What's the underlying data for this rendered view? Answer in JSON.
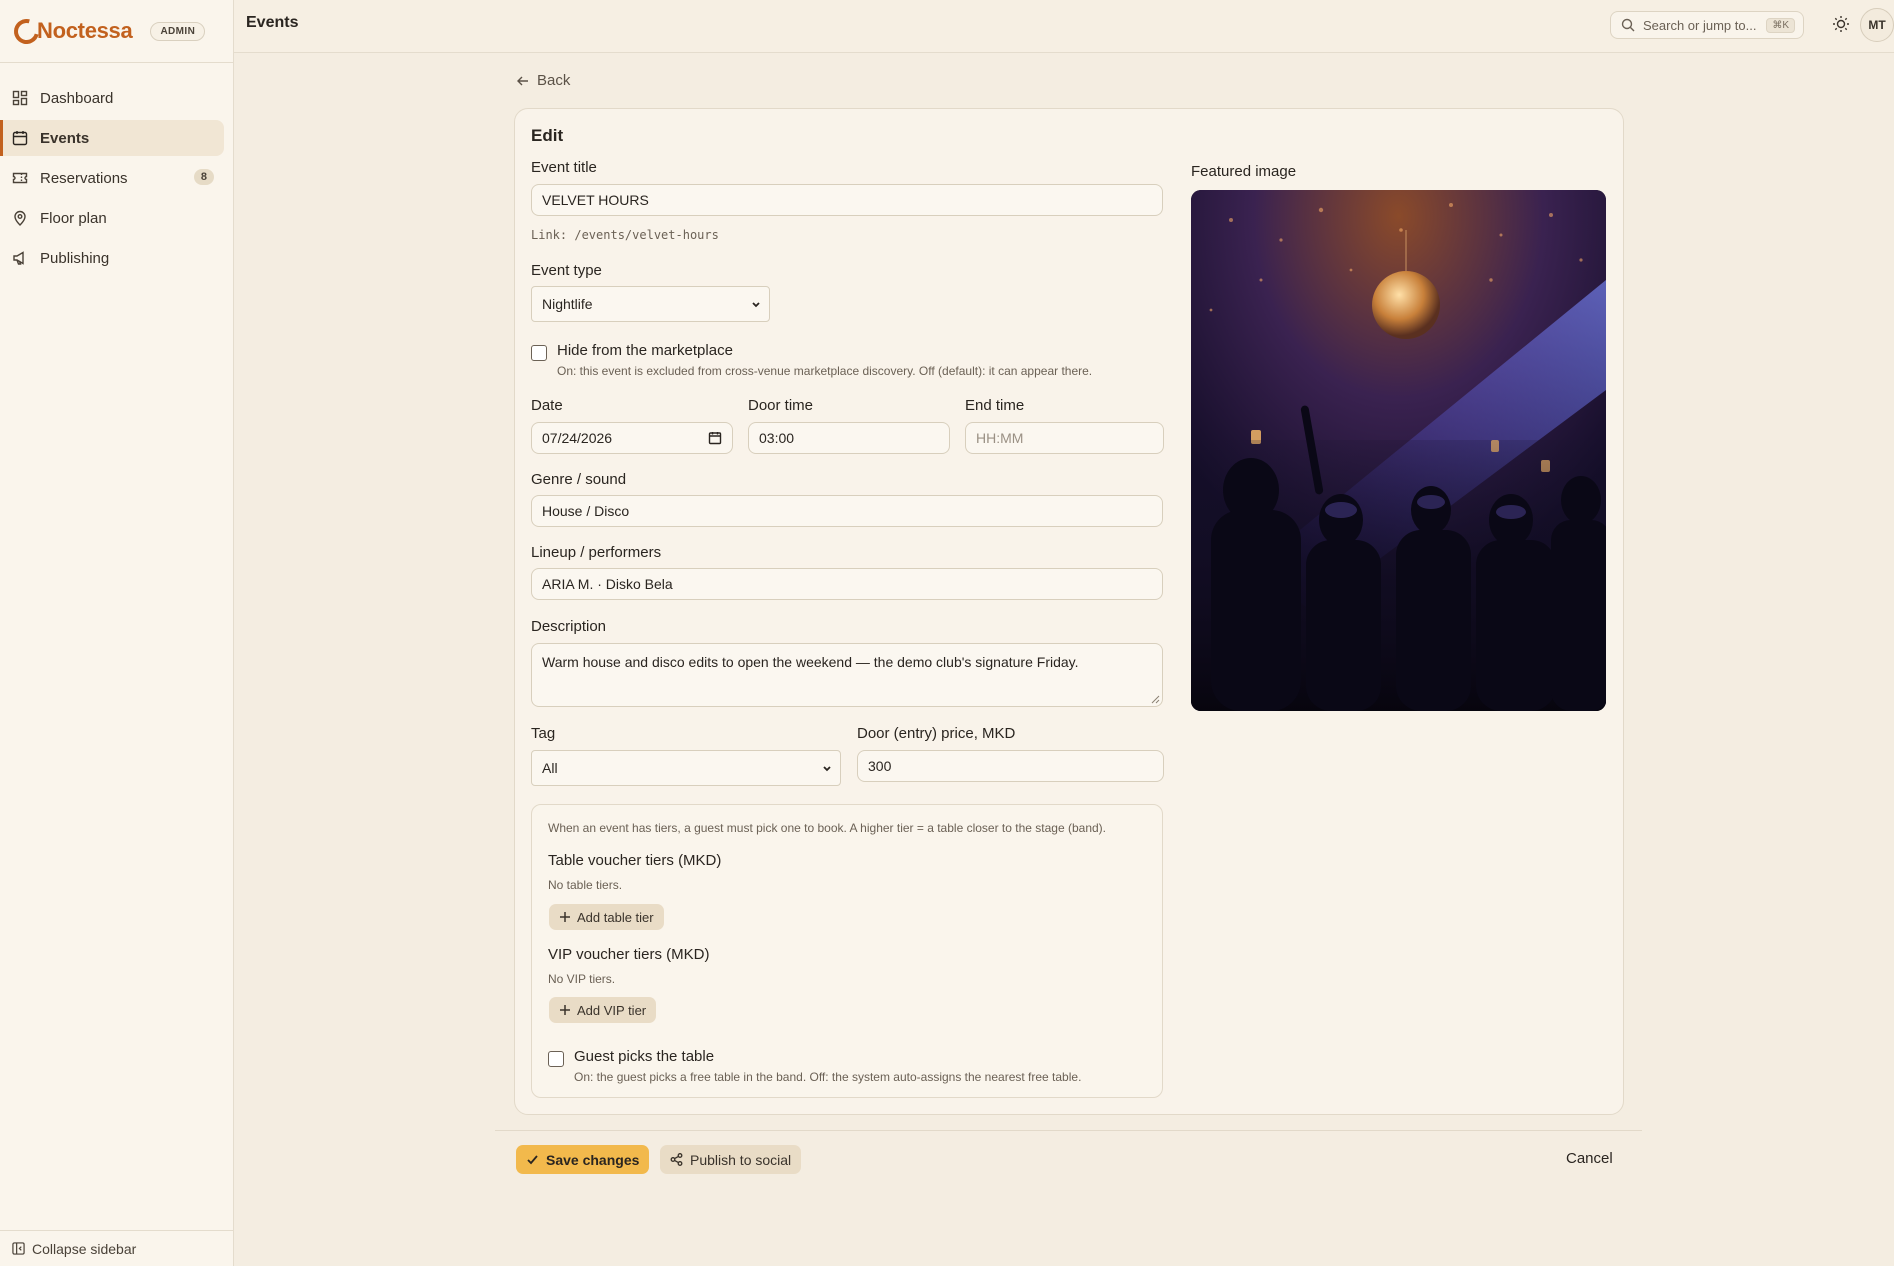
{
  "brand": {
    "name": "Noctessa",
    "badge": "ADMIN"
  },
  "sidebar": {
    "items": [
      {
        "label": "Dashboard",
        "icon": "grid-icon",
        "active": false
      },
      {
        "label": "Events",
        "icon": "calendar-icon",
        "active": true
      },
      {
        "label": "Reservations",
        "icon": "ticket-icon",
        "active": false,
        "badge": "8"
      },
      {
        "label": "Floor plan",
        "icon": "map-pin-icon",
        "active": false
      },
      {
        "label": "Publishing",
        "icon": "megaphone-icon",
        "active": false
      }
    ],
    "collapse_label": "Collapse sidebar"
  },
  "topbar": {
    "title": "Events",
    "search_placeholder": "Search or jump to...",
    "search_shortcut": "⌘K",
    "avatar_initials": "MT"
  },
  "page": {
    "back_label": "Back",
    "card_title": "Edit"
  },
  "form": {
    "title_label": "Event title",
    "title_value": "VELVET HOURS",
    "link_text": "Link: /events/velvet-hours",
    "type_label": "Event type",
    "type_value": "Nightlife",
    "hide_label": "Hide from the marketplace",
    "hide_hint": "On: this event is excluded from cross-venue marketplace discovery. Off (default): it can appear there.",
    "date_label": "Date",
    "date_value": "07/24/2026",
    "door_label": "Door time",
    "door_value": "03:00",
    "end_label": "End time",
    "end_placeholder": "HH:MM",
    "genre_label": "Genre / sound",
    "genre_value": "House / Disco",
    "lineup_label": "Lineup / performers",
    "lineup_value": "ARIA M. · Disko Bela",
    "desc_label": "Description",
    "desc_value": "Warm house and disco edits to open the weekend — the demo club's signature Friday.",
    "tag_label": "Tag",
    "tag_value": "All",
    "price_label": "Door (entry) price, MKD",
    "price_value": "300"
  },
  "tiers": {
    "intro": "When an event has tiers, a guest must pick one to book. A higher tier = a table closer to the stage (band).",
    "table_title": "Table voucher tiers (MKD)",
    "table_empty": "No table tiers.",
    "table_add": "Add table tier",
    "vip_title": "VIP voucher tiers (MKD)",
    "vip_empty": "No VIP tiers.",
    "vip_add": "Add VIP tier",
    "guest_label": "Guest picks the table",
    "guest_hint": "On: the guest picks a free table in the band. Off: the system auto-assigns the nearest free table."
  },
  "image": {
    "label": "Featured image"
  },
  "actions": {
    "save": "Save changes",
    "publish": "Publish to social",
    "cancel": "Cancel"
  },
  "colors": {
    "accent": "#c2611e",
    "primary_button": "#f2b94c",
    "background": "#f4ede1"
  }
}
